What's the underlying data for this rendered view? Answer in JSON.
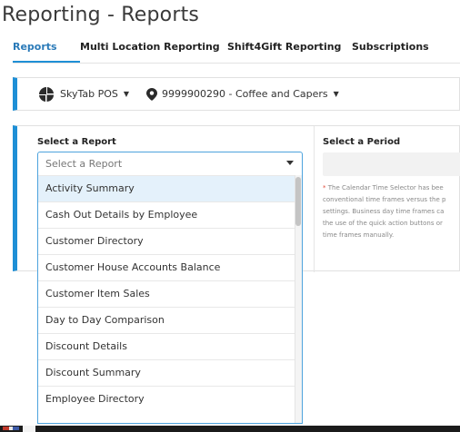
{
  "page": {
    "title": "Reporting - Reports"
  },
  "tabs": [
    {
      "label": "Reports",
      "active": true
    },
    {
      "label": "Multi Location Reporting",
      "active": false
    },
    {
      "label": "Shift4Gift Reporting",
      "active": false
    },
    {
      "label": "Subscriptions",
      "active": false
    }
  ],
  "location_bar": {
    "brand_label": "SkyTab POS",
    "brand_icon": "skytab-logo-icon",
    "location_icon": "map-pin-icon",
    "location_label": "9999900290 - Coffee and Capers"
  },
  "report_panel": {
    "heading": "Select a Report",
    "select_placeholder": "Select a Report",
    "options": [
      "Activity Summary",
      "Cash Out Details by Employee",
      "Customer Directory",
      "Customer House Accounts Balance",
      "Customer Item Sales",
      "Day to Day Comparison",
      "Discount Details",
      "Discount Summary",
      "Employee Directory"
    ],
    "highlighted_index": 0
  },
  "period_panel": {
    "heading": "Select a Period",
    "note_asterisk": "*",
    "note_line1": " The Calendar Time Selector has bee",
    "note_line2": "conventional time frames versus the p",
    "note_line3": "settings. Business day time frames ca",
    "note_line4": "the use of the quick action buttons or",
    "note_line5": "time frames manually."
  },
  "colors": {
    "accent": "#1e8fd6",
    "tab_active_text": "#2a7ab8",
    "highlight_row": "#e4f1fb",
    "asterisk": "#e04a3a"
  }
}
